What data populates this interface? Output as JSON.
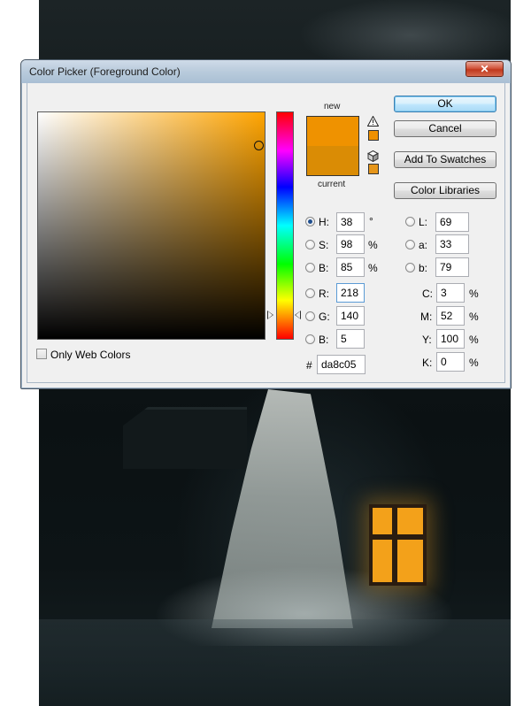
{
  "dialog": {
    "title": "Color Picker (Foreground Color)",
    "close_label": "✕"
  },
  "preview": {
    "new_label": "new",
    "current_label": "current",
    "new_color": "#ef9200",
    "current_color": "#da8c05",
    "warning_icon": "gamut-warning-icon",
    "cube_icon": "web-safe-cube-icon",
    "warning_swatch_color": "#ef9000",
    "cube_swatch_color": "#e6961a"
  },
  "field": {
    "gradient_hue_color": "#ffa400"
  },
  "buttons": {
    "ok": "OK",
    "cancel": "Cancel",
    "add_to_swatches": "Add To Swatches",
    "color_libraries": "Color Libraries"
  },
  "hsb": {
    "h_label": "H:",
    "h_value": "38",
    "h_unit": "°",
    "s_label": "S:",
    "s_value": "98",
    "s_unit": "%",
    "b_label": "B:",
    "b_value": "85",
    "b_unit": "%"
  },
  "rgb": {
    "r_label": "R:",
    "r_value": "218",
    "g_label": "G:",
    "g_value": "140",
    "b_label": "B:",
    "b_value": "5"
  },
  "lab": {
    "l_label": "L:",
    "l_value": "69",
    "a_label": "a:",
    "a_value": "33",
    "b_label": "b:",
    "b_value": "79"
  },
  "cmyk": {
    "c_label": "C:",
    "c_value": "3",
    "c_unit": "%",
    "m_label": "M:",
    "m_value": "52",
    "m_unit": "%",
    "y_label": "Y:",
    "y_value": "100",
    "y_unit": "%",
    "k_label": "K:",
    "k_value": "0",
    "k_unit": "%"
  },
  "hex": {
    "label": "#",
    "value": "da8c05"
  },
  "options": {
    "only_web_colors": "Only Web Colors"
  }
}
